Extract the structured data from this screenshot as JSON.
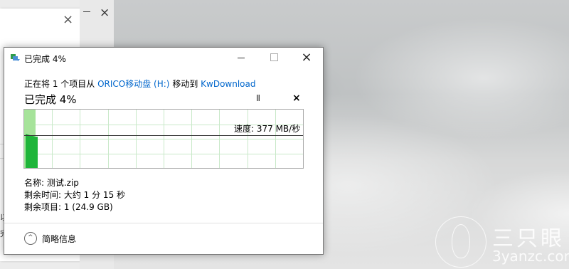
{
  "dialog": {
    "title": "已完成 4%",
    "description": {
      "prefix": "正在将 1 个项目从 ",
      "source": "ORICO移动盘 (H:)",
      "middle": " 移动到 ",
      "destination": "KwDownload"
    },
    "status_title": "已完成 4%",
    "pause_glyph": "II",
    "cancel_glyph": "×",
    "speed": "速度: 377 MB/秒",
    "progress_fraction": 0.04,
    "name": "名称: 测试.zip",
    "time_remaining": "剩余时间: 大约 1 分 15 秒",
    "items_remaining": "剩余项目: 1 (24.9 GB)",
    "details_label": "简略信息",
    "details_glyph": "^",
    "window_close": "×"
  },
  "background": {
    "back_close": "×",
    "back_close2": "×",
    "fragment1": "以",
    "fragment2": "完"
  },
  "watermark": {
    "name": "三只眼",
    "url": "3yanzc.com"
  },
  "colors": {
    "link": "#0066cc",
    "progress_fill": "#a6e39a",
    "speed_bar": "#1fb53a"
  }
}
